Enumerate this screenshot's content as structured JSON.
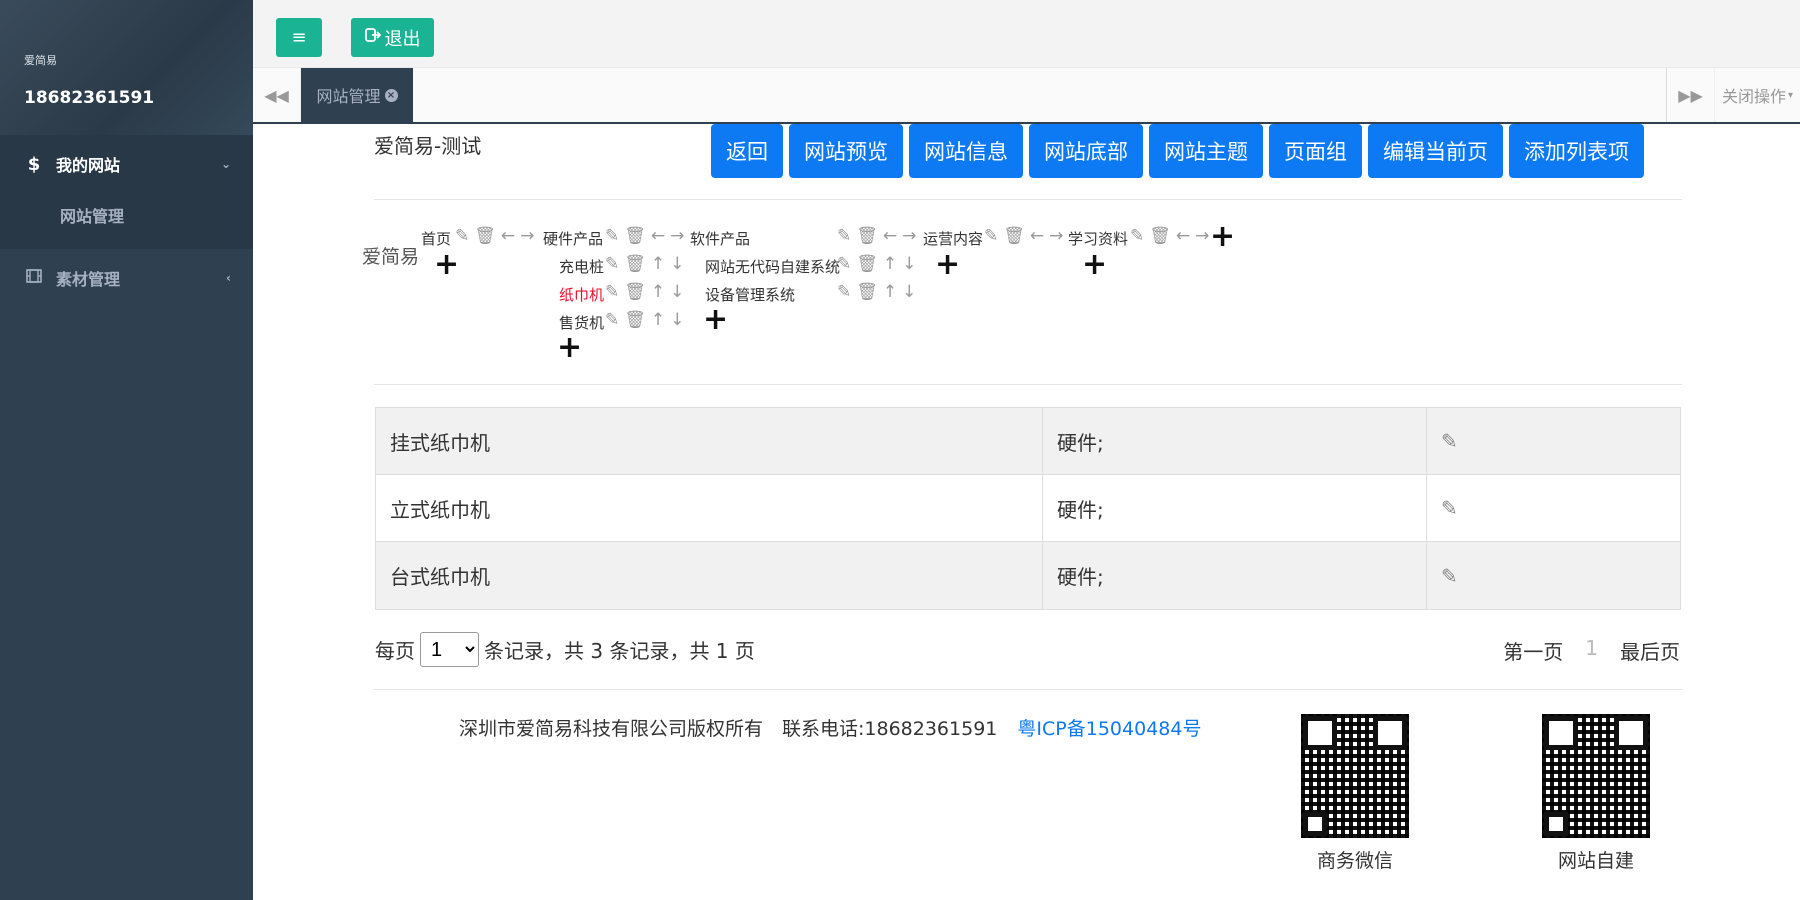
{
  "sidebar": {
    "profile_name": "爱简易",
    "profile_phone": "18682361591",
    "menu": [
      {
        "label": "我的网站",
        "icon": "dollar-icon",
        "arrow": "⌄"
      },
      {
        "label": "素材管理",
        "icon": "film-icon",
        "arrow": "‹"
      }
    ],
    "submenu": [
      {
        "label": "网站管理"
      }
    ]
  },
  "topbar": {
    "menu_glyph": "≡",
    "exit_label": "退出"
  },
  "tabs": {
    "active_label": "网站管理",
    "close_ops_label": "关闭操作"
  },
  "main": {
    "site_title": "爱简易-测试",
    "actions": [
      "返回",
      "网站预览",
      "网站信息",
      "网站底部",
      "网站主题",
      "页面组",
      "编辑当前页",
      "添加列表项"
    ]
  },
  "tree": {
    "root": "爱简易",
    "nodes": {
      "home": "首页",
      "hardware": "硬件产品",
      "software": "软件产品",
      "operations": "运营内容",
      "learning": "学习资料",
      "charging": "充电桩",
      "tissue": "纸巾机",
      "vending": "售货机",
      "nocode": "网站无代码自建系统",
      "device": "设备管理系统"
    }
  },
  "table": {
    "rows": [
      {
        "name": "挂式纸巾机",
        "category": "硬件;"
      },
      {
        "name": "立式纸巾机",
        "category": "硬件;"
      },
      {
        "name": "台式纸巾机",
        "category": "硬件;"
      }
    ]
  },
  "pager": {
    "per_page_label": "每页",
    "per_page_value": "1",
    "summary": "条记录，共 3 条记录，共 1 页",
    "first": "第一页",
    "current": "1",
    "last": "最后页"
  },
  "footer": {
    "copyright": "深圳市爱简易科技有限公司版权所有　联系电话:18682361591",
    "icp": "粤ICP备15040484号",
    "qr1_caption": "商务微信",
    "qr2_caption": "网站自建"
  }
}
